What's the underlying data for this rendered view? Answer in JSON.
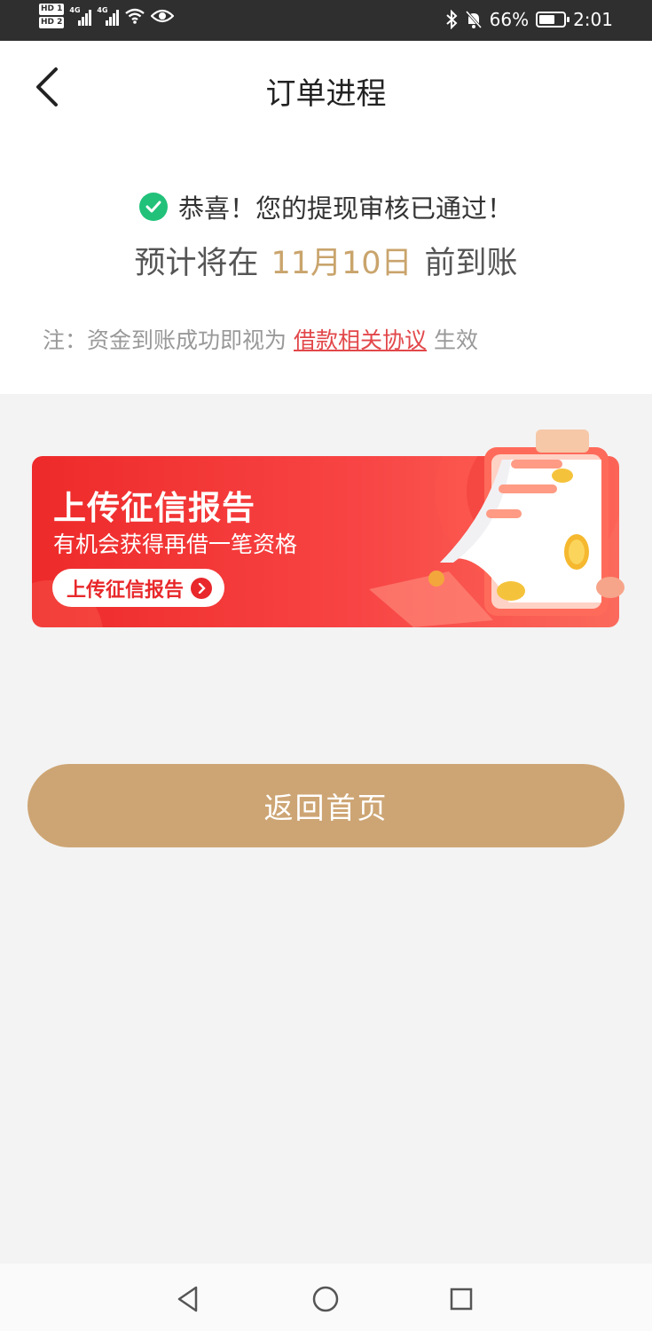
{
  "status_bar": {
    "hd1": "HD 1",
    "hd2": "HD 2",
    "net1": "4G",
    "net2": "4G",
    "battery_text": "66%",
    "battery_level": 0.66,
    "time": "2:01",
    "icons": [
      "signal-icon",
      "wifi-icon",
      "eye-icon",
      "bluetooth-icon",
      "bell-off-icon",
      "battery-icon"
    ]
  },
  "header": {
    "title": "订单进程",
    "back_icon": "chevron-left-icon"
  },
  "result": {
    "status_icon": "check-circle-icon",
    "message": "恭喜！您的提现审核已通过！",
    "eta_prefix": "预计将在",
    "eta_date": "11月10日",
    "eta_suffix": "前到账",
    "note_prefix": "注：资金到账成功即视为",
    "note_link": "借款相关协议",
    "note_suffix": "生效"
  },
  "banner": {
    "title": "上传征信报告",
    "subtitle": "有机会获得再借一笔资格",
    "button_label": "上传征信报告"
  },
  "actions": {
    "home_button": "返回首页"
  },
  "nav_bar": {
    "icons": [
      "back-triangle-icon",
      "home-circle-icon",
      "recents-square-icon"
    ]
  },
  "colors": {
    "accent_gold": "#cda574",
    "date_gold": "#c9a46c",
    "link_red": "#e2474a",
    "success_green": "#21c17a",
    "banner_red": "#ee2a2a"
  }
}
